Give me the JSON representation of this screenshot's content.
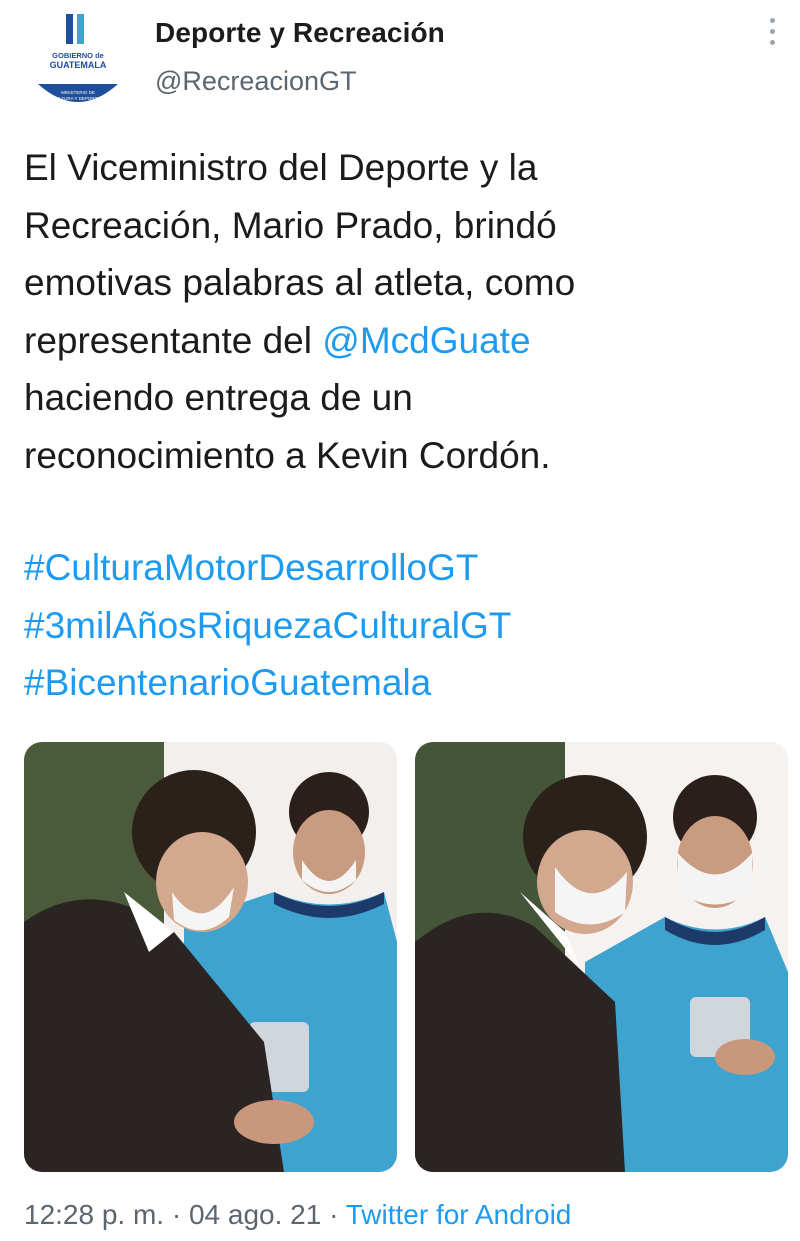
{
  "account": {
    "display_name": "Deporte y Recreación",
    "handle": "@RecreacionGT",
    "avatar_logo_text": "GOBIERNO de GUATEMALA",
    "avatar_logo_subtext": "MINISTERIO DE CULTURA Y DEPORTES"
  },
  "tweet": {
    "lines": [
      "El Viceministro del Deporte y la",
      "Recreación, Mario Prado, brindó",
      "emotivas palabras al atleta, como",
      "representante del ",
      "haciendo entrega de un",
      "reconocimiento a Kevin Cordón."
    ],
    "mention": "@McdGuate",
    "hashtags": [
      "#CulturaMotorDesarrolloGT",
      "#3milAñosRiquezaCulturalGT",
      "#BicentenarioGuatemala"
    ]
  },
  "media": {
    "photo_count": 2
  },
  "meta": {
    "time": "12:28 p. m.",
    "separator": " · ",
    "date": "04 ago. 21",
    "source": "Twitter for Android"
  },
  "colors": {
    "link": "#1d9bf0",
    "text": "#1b1b1b",
    "muted": "#5b6670",
    "jersey": "#3fa3cf",
    "logo_blue": "#1f4e9b"
  }
}
